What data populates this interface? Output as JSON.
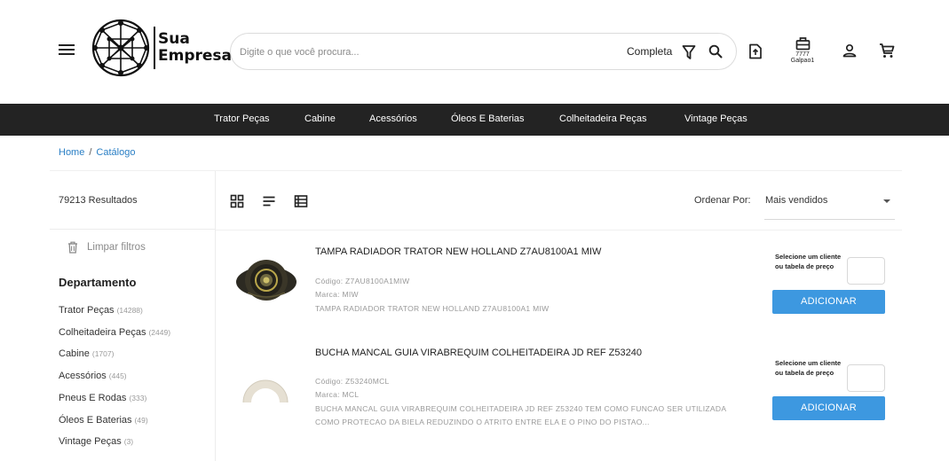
{
  "brand": {
    "line1": "Sua",
    "line2": "Empresa"
  },
  "search": {
    "placeholder": "Digite o que você procura...",
    "mode": "Completa"
  },
  "store": {
    "line1": "7777",
    "line2": "Galpao1"
  },
  "nav": [
    "Trator Peças",
    "Cabine",
    "Acessórios",
    "Óleos E Baterias",
    "Colheitadeira Peças",
    "Vintage Peças"
  ],
  "breadcrumb": {
    "home": "Home",
    "separator": "/",
    "current": "Catálogo"
  },
  "results": {
    "count_text": "79213 Resultados"
  },
  "filters": {
    "clear_label": "Limpar filtros",
    "department_title": "Departamento",
    "departments": [
      {
        "name": "Trator Peças",
        "count": "(14288)"
      },
      {
        "name": "Colheitadeira Peças",
        "count": "(2449)"
      },
      {
        "name": "Cabine",
        "count": "(1707)"
      },
      {
        "name": "Acessórios",
        "count": "(445)"
      },
      {
        "name": "Pneus E Rodas",
        "count": "(333)"
      },
      {
        "name": "Óleos E Baterias",
        "count": "(49)"
      },
      {
        "name": "Vintage Peças",
        "count": "(3)"
      }
    ]
  },
  "sort": {
    "label": "Ordenar Por:",
    "value": "Mais vendidos"
  },
  "view_modes": [
    "grid-view-icon",
    "list-view-icon",
    "table-view-icon"
  ],
  "products": [
    {
      "name": "TAMPA RADIADOR TRATOR NEW HOLLAND Z7AU8100A1 MIW",
      "code": "Código: Z7AU8100A1MIW",
      "brand": "Marca: MIW",
      "description": "TAMPA RADIADOR TRATOR NEW HOLLAND Z7AU8100A1 MIW",
      "price_note": "Selecione um cliente ou tabela de preço",
      "button": "ADICIONAR",
      "image_icon": "radiator-cap-image"
    },
    {
      "name": "BUCHA MANCAL GUIA VIRABREQUIM COLHEITADEIRA JD REF Z53240",
      "code": "Código: Z53240MCL",
      "brand": "Marca: MCL",
      "description": "BUCHA MANCAL GUIA VIRABREQUIM COLHEITADEIRA JD REF Z53240 TEM COMO FUNCAO SER UTILIZADA COMO PROTECAO DA BIELA REDUZINDO O ATRITO ENTRE ELA E O PINO DO PISTAO...",
      "price_note": "Selecione um cliente ou tabela de preço",
      "button": "ADICIONAR",
      "image_icon": "bushing-image"
    }
  ],
  "colors": {
    "nav_bg": "#232323",
    "accent": "#3d98e0",
    "link": "#2a7fc5"
  },
  "icons": [
    "menu-icon",
    "filter-icon",
    "search-icon",
    "quote-document-icon",
    "store-icon",
    "user-icon",
    "cart-icon",
    "trash-icon"
  ]
}
